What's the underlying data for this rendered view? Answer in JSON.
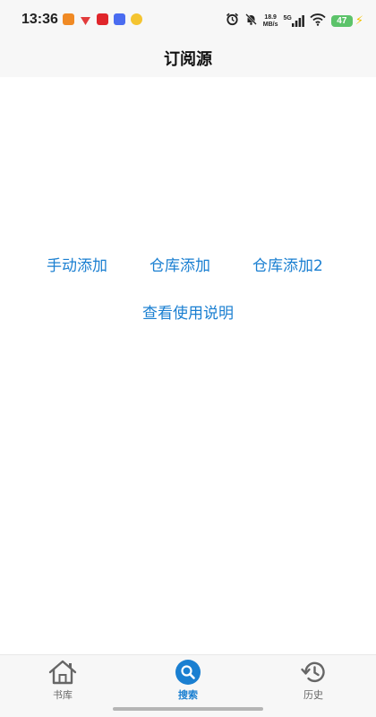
{
  "status_bar": {
    "time": "13:36",
    "net_speed_value": "18.9",
    "net_speed_unit": "MB/s",
    "network_type": "5G",
    "battery": "47"
  },
  "header": {
    "title": "订阅源"
  },
  "actions": {
    "manual_add": "手动添加",
    "repo_add": "仓库添加",
    "repo_add_2": "仓库添加2",
    "help": "查看使用说明"
  },
  "nav": {
    "items": [
      {
        "label": "书库",
        "icon": "home-icon",
        "active": false
      },
      {
        "label": "搜索",
        "icon": "search-icon",
        "active": true
      },
      {
        "label": "历史",
        "icon": "history-icon",
        "active": false
      }
    ]
  },
  "colors": {
    "accent": "#1a7fd1",
    "bar_background": "#f7f7f7",
    "battery": "#5cc36a"
  }
}
